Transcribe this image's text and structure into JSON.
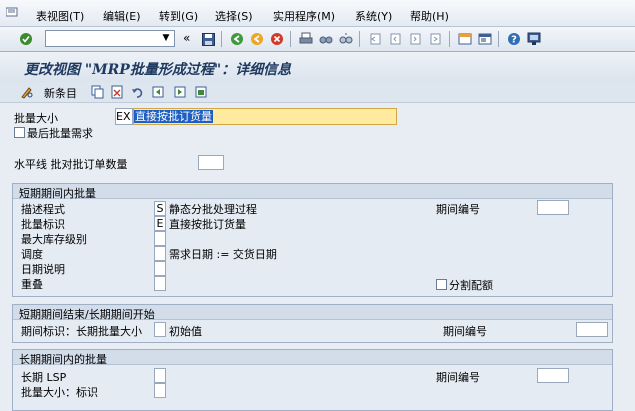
{
  "menubar": {
    "items": [
      "表视图(T)",
      "编辑(E)",
      "转到(G)",
      "选择(S)",
      "实用程序(M)",
      "系统(Y)",
      "帮助(H)"
    ]
  },
  "toolbar": {
    "command_field_value": "",
    "icons": [
      "enter-check-icon",
      "save-icon",
      "back-icon",
      "exit-icon",
      "cancel-icon",
      "print-icon",
      "find-icon",
      "find-next-icon",
      "first-page-icon",
      "prev-page-icon",
      "next-page-icon",
      "last-page-icon",
      "new-session-icon",
      "shortcut-icon",
      "help-icon",
      "customize-layout-icon"
    ],
    "double_arrow": "«"
  },
  "title": "更改视图 \"MRP批量形成过程\"：详细信息",
  "app_toolbar": {
    "new_entries_label": "新条目",
    "icons": [
      "pencil-glasses-icon",
      "copy-icon",
      "delete-icon",
      "undo-icon",
      "previous-entry-icon",
      "next-entry-icon",
      "other-entry-icon"
    ]
  },
  "header": {
    "lot_size_label": "批量大小",
    "lot_size_code": "EX",
    "lot_size_value": "直接按批订货量",
    "last_lot_label": "最后批量需求",
    "horizon_label": "水平线 批对批订单数量"
  },
  "short_term": {
    "title": "短期期间内批量",
    "rows": [
      {
        "label": "描述程式",
        "value": "S",
        "desc": "静态分批处理过程"
      },
      {
        "label": "批量标识",
        "value": "E",
        "desc": "直接按批订货量"
      },
      {
        "label": "最大库存级别",
        "value": "",
        "desc": ""
      },
      {
        "label": "调度",
        "value": "",
        "desc": "需求日期 := 交货日期"
      },
      {
        "label": "日期说明",
        "value": "",
        "desc": ""
      },
      {
        "label": "重叠",
        "value": "",
        "desc": ""
      }
    ],
    "period_no_label": "期间编号",
    "split_quota_label": "分割配额"
  },
  "end_short": {
    "title": "短期期间结束/长期期间开始",
    "period_ind_label": "期间标识：长期批量大小",
    "initial_value_label": "初始值",
    "period_no_label": "期间编号"
  },
  "long_term": {
    "title": "长期期间内的批量",
    "rows": [
      {
        "label": "长期 LSP"
      },
      {
        "label": "批量大小：标识"
      }
    ],
    "period_no_label": "期间编号"
  }
}
